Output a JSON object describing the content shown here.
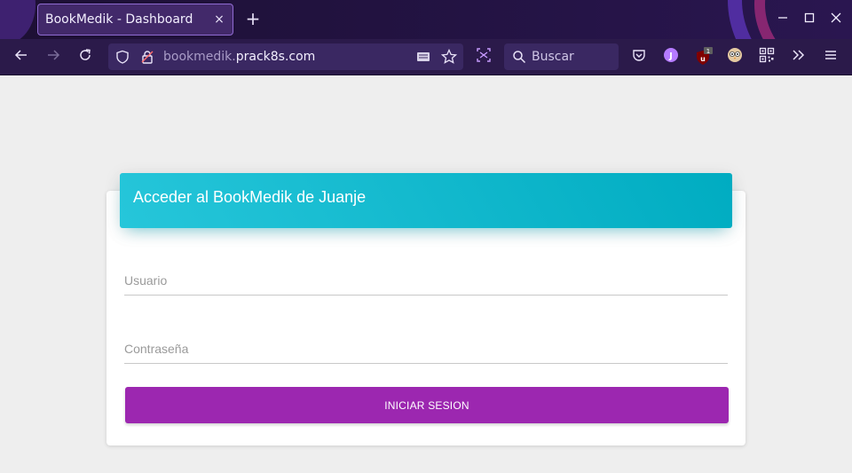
{
  "browser": {
    "tab_title": "BookMedik - Dashboard",
    "tab_close": "×",
    "new_tab": "+",
    "url_subdomain": "bookmedik.",
    "url_domain": "prack8s.com",
    "search_placeholder": "Buscar",
    "extensions": [
      {
        "name": "pocket-icon"
      },
      {
        "name": "profile-j-icon",
        "letter": "J"
      },
      {
        "name": "ublock-icon",
        "badge": "1"
      },
      {
        "name": "owl-extension-icon"
      },
      {
        "name": "qr-code-icon"
      }
    ]
  },
  "page": {
    "header_title": "Acceder al BookMedik de Juanje",
    "username_placeholder": "Usuario",
    "password_placeholder": "Contraseña",
    "submit_label": "INICIAR SESION"
  },
  "colors": {
    "browser_frame": "#2b1a4a",
    "header_cyan": "#00acc1",
    "button_purple": "#9c27b0",
    "page_background": "#eeeeee"
  }
}
